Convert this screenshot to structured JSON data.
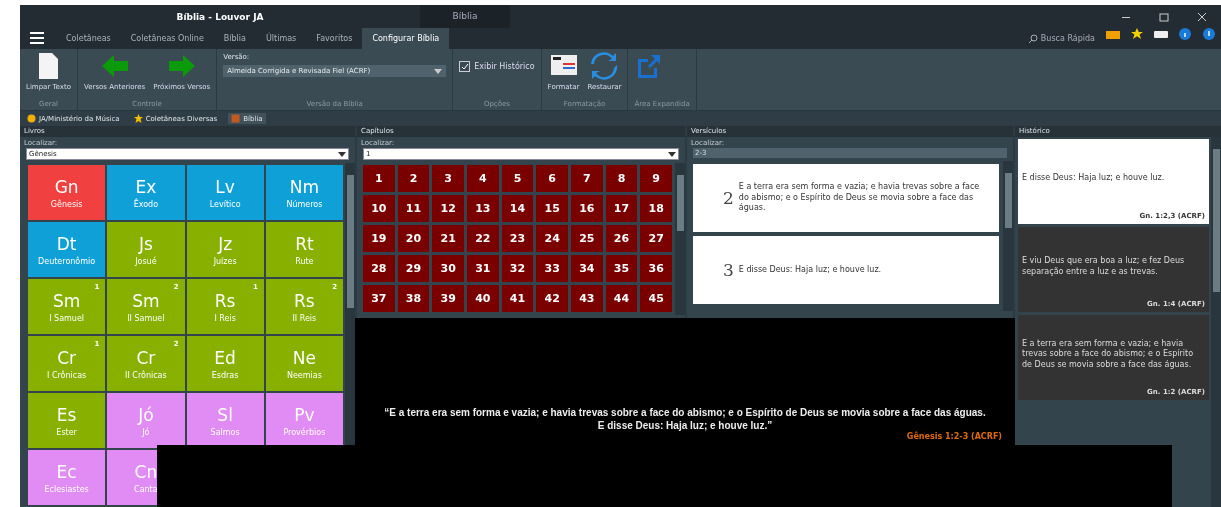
{
  "window": {
    "title": "Bíblia - Louvor JA",
    "secondary_title": "Bíblia"
  },
  "menu_tabs": [
    {
      "label": "Coletâneas",
      "selected": false
    },
    {
      "label": "Coletâneas Online",
      "selected": false
    },
    {
      "label": "Bíblia",
      "selected": false
    },
    {
      "label": "Últimas",
      "selected": false
    },
    {
      "label": "Favoritos",
      "selected": false
    },
    {
      "label": "Configurar Bíblia",
      "selected": true
    }
  ],
  "quick_search": {
    "label": "Busca Rápida"
  },
  "ribbon": {
    "groups": [
      {
        "label": "Geral",
        "items": [
          {
            "kind": "doc",
            "label": "Limpar Texto"
          }
        ]
      },
      {
        "label": "Controle",
        "items": [
          {
            "kind": "prev",
            "label": "Versos Anteriores"
          },
          {
            "kind": "next",
            "label": "Próximos Versos"
          }
        ]
      },
      {
        "label": "Versão da Bíblia",
        "items": [
          {
            "kind": "select",
            "caption": "Versão:",
            "value": "Almeida Corrigida e Revisada Fiel (ACRF)"
          }
        ]
      },
      {
        "label": "Opções",
        "items": [
          {
            "kind": "checkbox",
            "label": "Exibir Histórico",
            "checked": true
          }
        ]
      },
      {
        "label": "Formatação",
        "items": [
          {
            "kind": "format",
            "label": "Formatar"
          },
          {
            "kind": "refresh",
            "label": "Restaurar"
          }
        ]
      },
      {
        "label": "Área Expandida",
        "items": [
          {
            "kind": "expand"
          }
        ]
      }
    ]
  },
  "doc_tabs": [
    {
      "label": "JA/Ministério da Música",
      "kind": "dot",
      "selected": false
    },
    {
      "label": "Coletâneas Diversas",
      "kind": "star",
      "selected": false
    },
    {
      "label": "Bíblia",
      "kind": "book",
      "selected": true
    }
  ],
  "books_panel": {
    "title": "Livros",
    "search_label": "Localizar:",
    "search_value": "Gênesis",
    "books": [
      {
        "abbr": "Gn",
        "name": "Gênesis",
        "color": "#f04040"
      },
      {
        "abbr": "Ex",
        "name": "Êxodo",
        "color": "#10a0d8"
      },
      {
        "abbr": "Lv",
        "name": "Levítico",
        "color": "#10a0d8"
      },
      {
        "abbr": "Nm",
        "name": "Números",
        "color": "#10a0d8"
      },
      {
        "abbr": "Dt",
        "name": "Deuteronômio",
        "color": "#10a0d8"
      },
      {
        "abbr": "Js",
        "name": "Josué",
        "color": "#88b000"
      },
      {
        "abbr": "Jz",
        "name": "Juízes",
        "color": "#88b000"
      },
      {
        "abbr": "Rt",
        "name": "Rute",
        "color": "#88b000"
      },
      {
        "abbr": "Sm",
        "number": "1",
        "name": "I Samuel",
        "color": "#88b000"
      },
      {
        "abbr": "Sm",
        "number": "2",
        "name": "II Samuel",
        "color": "#88b000"
      },
      {
        "abbr": "Rs",
        "number": "1",
        "name": "I Reis",
        "color": "#88b000"
      },
      {
        "abbr": "Rs",
        "number": "2",
        "name": "II Reis",
        "color": "#88b000"
      },
      {
        "abbr": "Cr",
        "number": "1",
        "name": "I Crônicas",
        "color": "#88b000"
      },
      {
        "abbr": "Cr",
        "number": "2",
        "name": "II Crônicas",
        "color": "#88b000"
      },
      {
        "abbr": "Ed",
        "name": "Esdras",
        "color": "#88b000"
      },
      {
        "abbr": "Ne",
        "name": "Neemias",
        "color": "#88b000"
      },
      {
        "abbr": "Es",
        "name": "Ester",
        "color": "#88b000"
      },
      {
        "abbr": "Jó",
        "name": "Jó",
        "color": "#e08cf4"
      },
      {
        "abbr": "Sl",
        "name": "Salmos",
        "color": "#e08cf4"
      },
      {
        "abbr": "Pv",
        "name": "Provérbios",
        "color": "#e08cf4"
      },
      {
        "abbr": "Ec",
        "name": "Eclesiastes",
        "color": "#e08cf4"
      },
      {
        "abbr": "Cn",
        "name": "Canta",
        "color": "#e08cf4"
      }
    ]
  },
  "chapters_panel": {
    "title": "Capítulos",
    "search_label": "Localizar:",
    "search_value": "1",
    "chapters": [
      "1",
      "2",
      "3",
      "4",
      "5",
      "6",
      "7",
      "8",
      "9",
      "10",
      "11",
      "12",
      "13",
      "14",
      "15",
      "16",
      "17",
      "18",
      "19",
      "20",
      "21",
      "22",
      "23",
      "24",
      "25",
      "26",
      "27",
      "28",
      "29",
      "30",
      "31",
      "32",
      "33",
      "34",
      "35",
      "36",
      "37",
      "38",
      "39",
      "40",
      "41",
      "42",
      "43",
      "44",
      "45"
    ]
  },
  "verses_panel": {
    "title": "Versículos",
    "search_label": "Localizar:",
    "search_value": "2-3",
    "verses": [
      {
        "number": "2",
        "text": "E a terra era sem forma e vazia; e havia trevas sobre a face do abismo; e o Espírito de Deus se movia sobre a face das águas."
      },
      {
        "number": "3",
        "text": "E disse Deus: Haja luz; e houve luz."
      }
    ]
  },
  "history_panel": {
    "title": "Histórico",
    "entries": [
      {
        "text": "E disse Deus: Haja luz; e houve luz.",
        "reference": "Gn. 1:2,3 (ACRF)",
        "selected": true
      },
      {
        "text": "E viu Deus que era boa a luz; e fez Deus separação entre a luz e as trevas.",
        "reference": "Gn. 1:4 (ACRF)",
        "selected": false
      },
      {
        "text": "E a terra era sem forma e vazia; e havia trevas sobre a face do abismo; e o Espírito de Deus se movia sobre a face das águas.",
        "reference": "Gn. 1:2 (ACRF)",
        "selected": false
      }
    ]
  },
  "projection": {
    "lines": [
      "“E a terra era sem forma e vazia; e havia trevas sobre a face do abismo; e o Espírito de Deus se movia sobre a face das águas.",
      "E disse Deus: Haja luz; e houve luz.”"
    ],
    "reference": "Gênesis 1:2-3 (ACRF)"
  }
}
